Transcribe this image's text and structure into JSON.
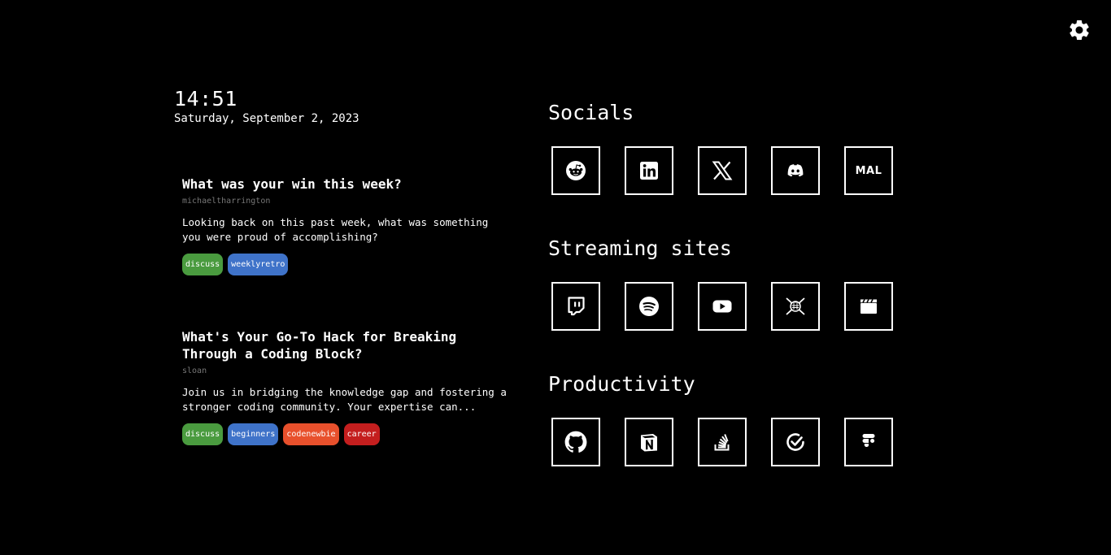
{
  "settings": {
    "icon": "gear-icon"
  },
  "clock": {
    "time": "14:51",
    "date": "Saturday, September 2, 2023"
  },
  "posts": [
    {
      "title": "What was your win this week?",
      "author": "michaeltharrington",
      "description": "Looking back on this past week, what was something you were proud of accomplishing?",
      "tags": [
        {
          "label": "discuss",
          "color": "#4a9b3f"
        },
        {
          "label": "weeklyretro",
          "color": "#3f73c9"
        }
      ]
    },
    {
      "title": "What's Your Go-To Hack for Breaking Through a Coding Block?",
      "author": "sloan",
      "description": "Join us in bridging the knowledge gap and fostering a stronger coding community. Your expertise can...",
      "tags": [
        {
          "label": "discuss",
          "color": "#4a9b3f"
        },
        {
          "label": "beginners",
          "color": "#3f73c9"
        },
        {
          "label": "codenewbie",
          "color": "#e8502c"
        },
        {
          "label": "career",
          "color": "#c41e1e"
        }
      ]
    }
  ],
  "sections": [
    {
      "title": "Socials",
      "links": [
        "reddit-icon",
        "linkedin-icon",
        "x-icon",
        "discord-icon",
        "mal-icon"
      ],
      "mal_text": "MAL"
    },
    {
      "title": "Streaming sites",
      "links": [
        "twitch-icon",
        "spotify-icon",
        "youtube-icon",
        "anime-site-icon",
        "clapperboard-icon"
      ]
    },
    {
      "title": "Productivity",
      "links": [
        "github-icon",
        "notion-icon",
        "stackoverflow-icon",
        "ticktick-icon",
        "figma-icon"
      ]
    }
  ]
}
